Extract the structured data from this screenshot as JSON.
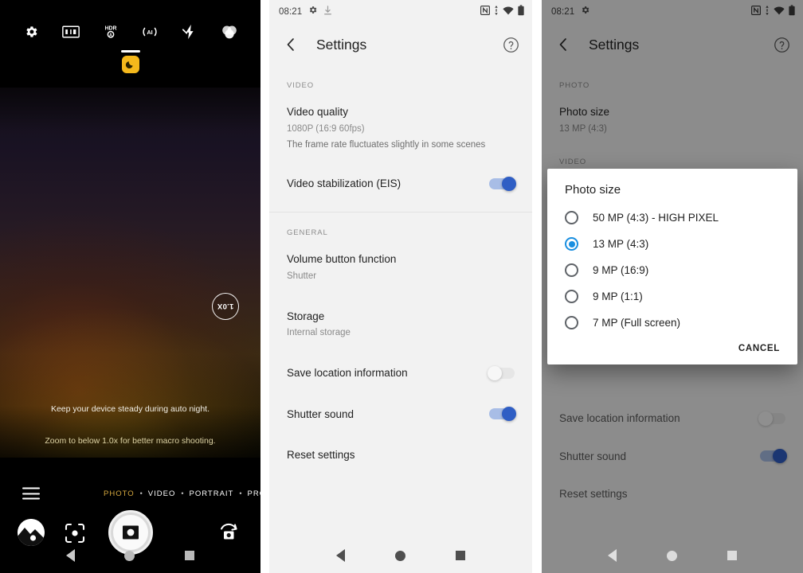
{
  "camera": {
    "top_icons": [
      {
        "name": "settings-gear-icon",
        "label": "Settings"
      },
      {
        "name": "aspect-ratio-icon",
        "label": "Aspect ratio"
      },
      {
        "name": "hdr-auto-icon",
        "label": "HDR Auto"
      },
      {
        "name": "ai-scene-icon",
        "label": "AI scene detection"
      },
      {
        "name": "flash-off-icon",
        "label": "Flash off"
      },
      {
        "name": "filters-icon",
        "label": "Filters"
      }
    ],
    "night_mode_badge": "night-mode-active-badge",
    "zoom_level": "1.0X",
    "hints": {
      "steady": "Keep your device steady during auto night.",
      "macro": "Zoom to below 1.0x for better macro shooting."
    },
    "modes": [
      "PHOTO",
      "VIDEO",
      "PORTRAIT",
      "PRO"
    ],
    "active_mode": "PHOTO",
    "mode_separator": "•",
    "bottom_controls": [
      {
        "name": "gallery-thumbnail-button"
      },
      {
        "name": "google-lens-button"
      },
      {
        "name": "shutter-button"
      },
      {
        "name": "flip-camera-button"
      }
    ],
    "colors": {
      "accent": "#d6a93f",
      "badge": "#f4b81c"
    }
  },
  "status_bar": {
    "time": "08:21",
    "left_icons": [
      "gear-icon",
      "download-icon"
    ],
    "right_icons": [
      "nfc-icon",
      "mobile-data-icon",
      "wifi-icon",
      "battery-icon"
    ]
  },
  "app_bar": {
    "title": "Settings",
    "back_icon": "back-chevron-icon",
    "help_icon": "help-circle-icon"
  },
  "settings_mid": {
    "sections": [
      {
        "header": "VIDEO",
        "rows": [
          {
            "name": "video-quality",
            "title": "Video quality",
            "subtitle": "1080P (16:9  60fps)",
            "subtitle2": "The frame rate fluctuates slightly in some scenes",
            "type": "link"
          },
          {
            "name": "video-stabilization",
            "title": "Video stabilization (EIS)",
            "type": "toggle",
            "value": true
          }
        ]
      },
      {
        "header": "GENERAL",
        "rows": [
          {
            "name": "volume-button-function",
            "title": "Volume button function",
            "subtitle": "Shutter",
            "type": "link"
          },
          {
            "name": "storage",
            "title": "Storage",
            "subtitle": "Internal storage",
            "type": "link"
          },
          {
            "name": "save-location-information",
            "title": "Save location information",
            "type": "toggle",
            "value": false
          },
          {
            "name": "shutter-sound",
            "title": "Shutter sound",
            "type": "toggle",
            "value": true
          },
          {
            "name": "reset-settings",
            "title": "Reset settings",
            "type": "link"
          }
        ]
      }
    ]
  },
  "settings_right": {
    "sections": [
      {
        "header": "PHOTO",
        "rows": [
          {
            "name": "photo-size",
            "title": "Photo size",
            "subtitle": "13 MP (4:3)",
            "type": "link"
          }
        ]
      },
      {
        "header": "VIDEO",
        "rows": []
      }
    ],
    "below_dialog_rows": [
      {
        "name": "save-location-information",
        "title": "Save location information",
        "type": "toggle",
        "value": false
      },
      {
        "name": "shutter-sound",
        "title": "Shutter sound",
        "type": "toggle",
        "value": true
      },
      {
        "name": "reset-settings",
        "title": "Reset settings",
        "type": "link"
      }
    ]
  },
  "dialog": {
    "title": "Photo size",
    "options": [
      {
        "label": "50 MP (4:3) - HIGH PIXEL",
        "selected": false
      },
      {
        "label": "13 MP (4:3)",
        "selected": true
      },
      {
        "label": "9 MP (16:9)",
        "selected": false
      },
      {
        "label": "9 MP (1:1)",
        "selected": false
      },
      {
        "label": "7 MP (Full screen)",
        "selected": false
      }
    ],
    "cancel_label": "CANCEL",
    "selected_color": "#1a8fe0"
  },
  "nav_bar": {
    "back": "back-triangle-icon",
    "home": "home-circle-icon",
    "recents": "recents-square-icon"
  }
}
